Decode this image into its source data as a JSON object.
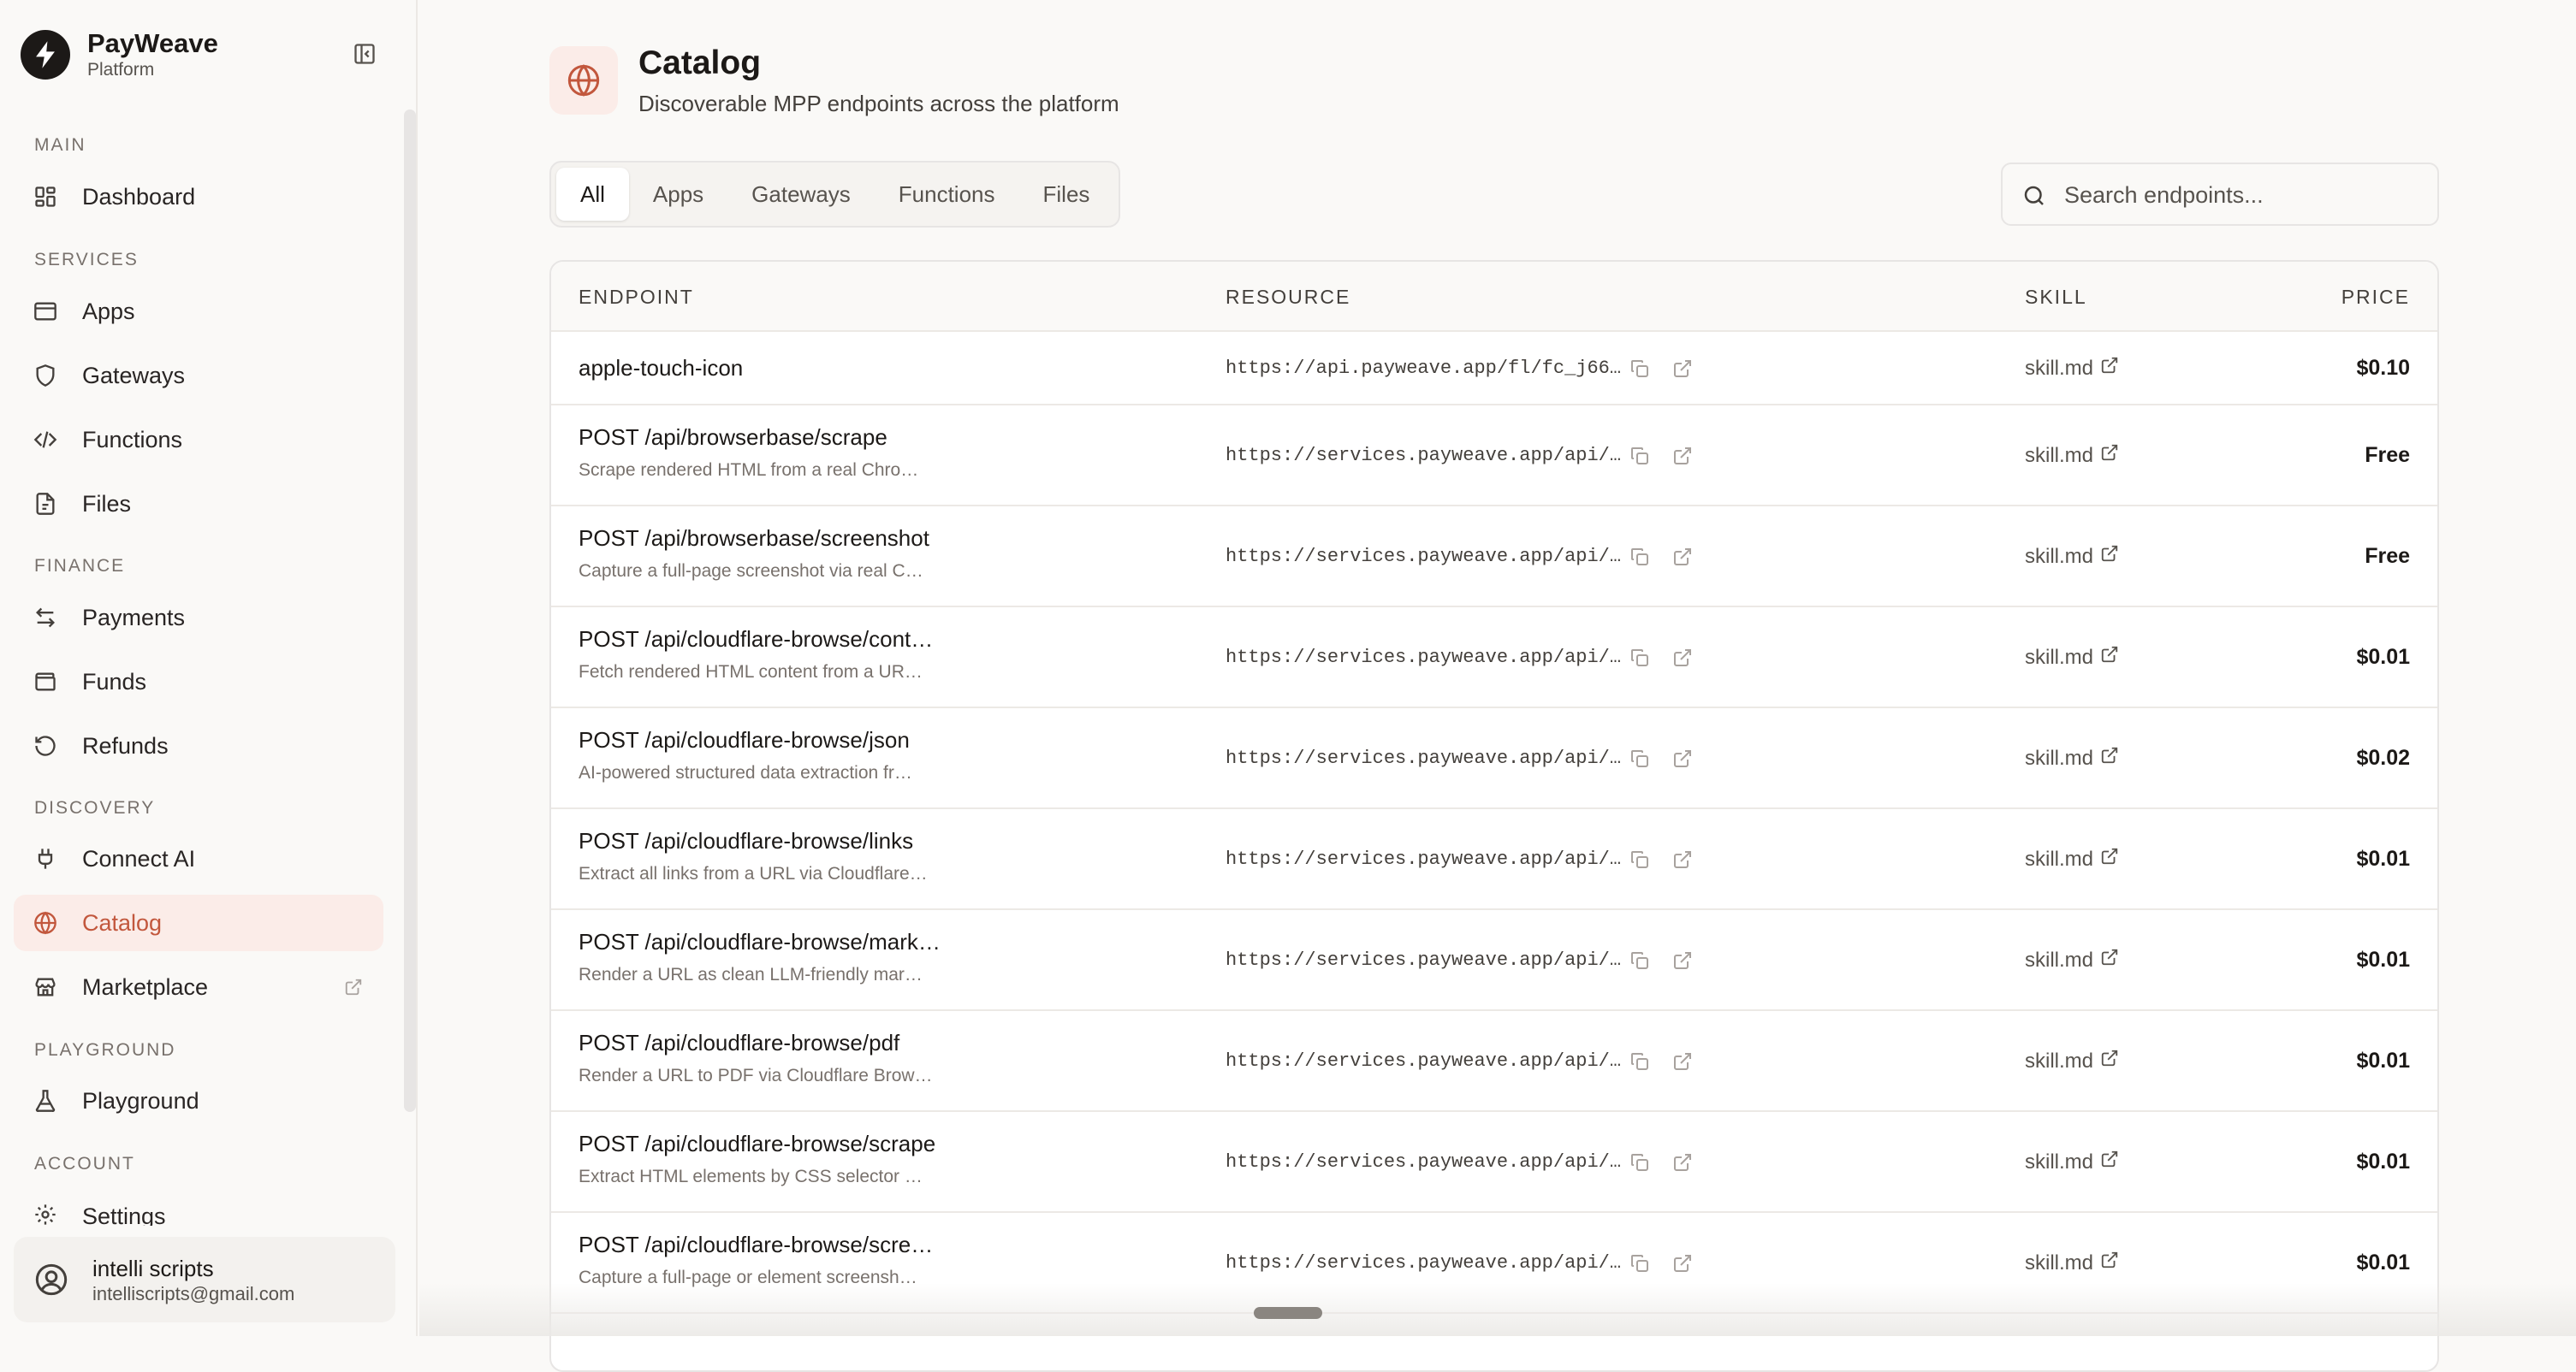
{
  "brand": {
    "name": "PayWeave",
    "subtitle": "Platform"
  },
  "nav": {
    "sections": {
      "main": "MAIN",
      "services": "SERVICES",
      "finance": "FINANCE",
      "discovery": "DISCOVERY",
      "playground": "PLAYGROUND",
      "account": "ACCOUNT"
    },
    "items": {
      "dashboard": "Dashboard",
      "apps": "Apps",
      "gateways": "Gateways",
      "functions": "Functions",
      "files": "Files",
      "payments": "Payments",
      "funds": "Funds",
      "refunds": "Refunds",
      "connect_ai": "Connect AI",
      "catalog": "Catalog",
      "marketplace": "Marketplace",
      "playground": "Playground",
      "settings": "Settings"
    },
    "active": "catalog"
  },
  "user": {
    "name": "intelli scripts",
    "email": "intelliscripts@gmail.com"
  },
  "page": {
    "title": "Catalog",
    "subtitle": "Discoverable MPP endpoints across the platform"
  },
  "tabs": [
    "All",
    "Apps",
    "Gateways",
    "Functions",
    "Files"
  ],
  "active_tab": "All",
  "search": {
    "placeholder": "Search endpoints..."
  },
  "table": {
    "headers": {
      "endpoint": "ENDPOINT",
      "resource": "RESOURCE",
      "skill": "SKILL",
      "price": "PRICE"
    },
    "rows": [
      {
        "title": "apple-touch-icon",
        "desc": "",
        "resource": "https://api.payweave.app/fl/fc_j66…",
        "skill": "skill.md",
        "price": "$0.10"
      },
      {
        "title": "POST /api/browserbase/scrape",
        "desc": "Scrape rendered HTML from a real Chro…",
        "resource": "https://services.payweave.app/api/…",
        "skill": "skill.md",
        "price": "Free"
      },
      {
        "title": "POST /api/browserbase/screenshot",
        "desc": "Capture a full-page screenshot via real C…",
        "resource": "https://services.payweave.app/api/…",
        "skill": "skill.md",
        "price": "Free"
      },
      {
        "title": "POST /api/cloudflare-browse/cont…",
        "desc": "Fetch rendered HTML content from a UR…",
        "resource": "https://services.payweave.app/api/…",
        "skill": "skill.md",
        "price": "$0.01"
      },
      {
        "title": "POST /api/cloudflare-browse/json",
        "desc": "AI-powered structured data extraction fr…",
        "resource": "https://services.payweave.app/api/…",
        "skill": "skill.md",
        "price": "$0.02"
      },
      {
        "title": "POST /api/cloudflare-browse/links",
        "desc": "Extract all links from a URL via Cloudflare…",
        "resource": "https://services.payweave.app/api/…",
        "skill": "skill.md",
        "price": "$0.01"
      },
      {
        "title": "POST /api/cloudflare-browse/mark…",
        "desc": "Render a URL as clean LLM-friendly mar…",
        "resource": "https://services.payweave.app/api/…",
        "skill": "skill.md",
        "price": "$0.01"
      },
      {
        "title": "POST /api/cloudflare-browse/pdf",
        "desc": "Render a URL to PDF via Cloudflare Brow…",
        "resource": "https://services.payweave.app/api/…",
        "skill": "skill.md",
        "price": "$0.01"
      },
      {
        "title": "POST /api/cloudflare-browse/scrape",
        "desc": "Extract HTML elements by CSS selector …",
        "resource": "https://services.payweave.app/api/…",
        "skill": "skill.md",
        "price": "$0.01"
      },
      {
        "title": "POST /api/cloudflare-browse/scre…",
        "desc": "Capture a full-page or element screensh…",
        "resource": "https://services.payweave.app/api/…",
        "skill": "skill.md",
        "price": "$0.01"
      }
    ]
  },
  "colors": {
    "accent": "#c2573d",
    "active_bg": "#fbece8",
    "text": "#1c1917",
    "muted": "#78716c"
  }
}
